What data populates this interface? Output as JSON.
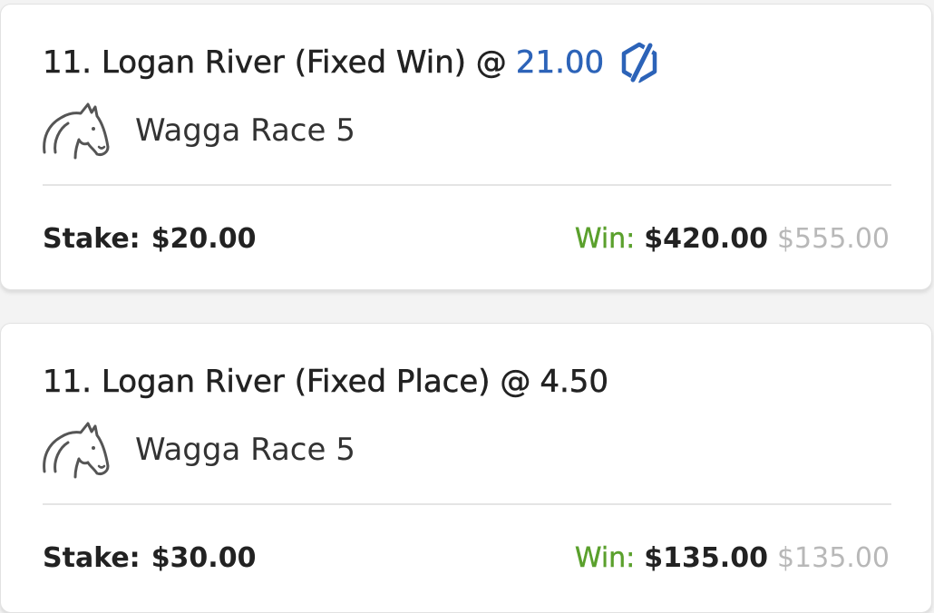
{
  "colors": {
    "boosted_odds": "#2c63b8",
    "win_label": "#5aa02c",
    "original_payout": "#b8b8b8",
    "card_background": "#ffffff",
    "page_background": "#f3f3f3"
  },
  "bets": [
    {
      "selection": "11. Logan River (Fixed Win) @",
      "odds": "21.00",
      "odds_boosted": true,
      "boost_icon": "boost-bolt-icon",
      "race_icon": "horse-head-icon",
      "race": "Wagga Race 5",
      "stake_label": "Stake:",
      "stake": "$20.00",
      "win_label": "Win:",
      "win": "$420.00",
      "win_original": "$555.00"
    },
    {
      "selection": "11. Logan River (Fixed Place) @",
      "odds": "4.50",
      "odds_boosted": false,
      "race_icon": "horse-head-icon",
      "race": "Wagga Race 5",
      "stake_label": "Stake:",
      "stake": "$30.00",
      "win_label": "Win:",
      "win": "$135.00",
      "win_original": "$135.00"
    }
  ]
}
